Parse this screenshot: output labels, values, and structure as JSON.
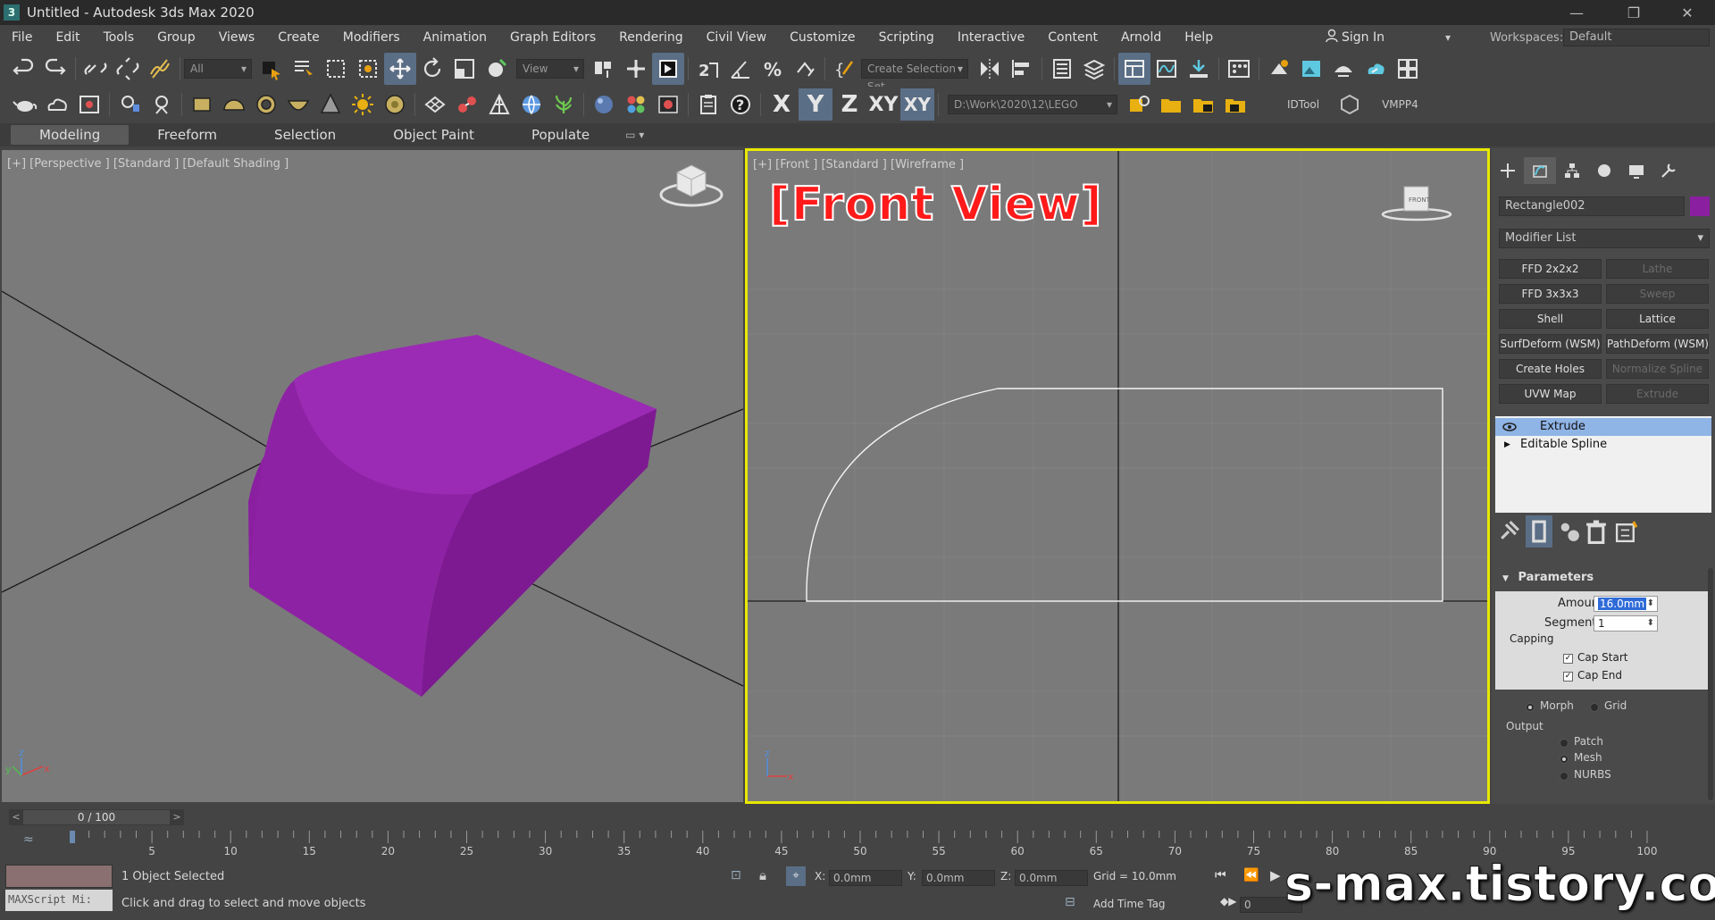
{
  "window": {
    "logo": "3",
    "title": "Untitled - Autodesk 3ds Max 2020",
    "minimize": "—",
    "maximize": "❐",
    "close": "✕"
  },
  "menu": {
    "items": [
      "File",
      "Edit",
      "Tools",
      "Group",
      "Views",
      "Create",
      "Modifiers",
      "Animation",
      "Graph Editors",
      "Rendering",
      "Civil View",
      "Customize",
      "Scripting",
      "Interactive",
      "Content",
      "Arnold",
      "Help"
    ],
    "sign_in": "Sign In",
    "workspaces_label": "Workspaces:",
    "workspace_value": "Default"
  },
  "toolbar1": {
    "filter_dropdown": "All",
    "refcoord_dropdown": "View",
    "selection_set": "Create Selection Set"
  },
  "toolbar2": {
    "axis_x": "X",
    "axis_y": "Y",
    "axis_z": "Z",
    "axis_xy": "XY",
    "axis_xy2": "XY",
    "project_path": "D:\\Work\\2020\\12\\LEGO",
    "idtool": "IDTool",
    "vmpp": "VMPP4"
  },
  "ribbon": {
    "tabs": [
      "Modeling",
      "Freeform",
      "Selection",
      "Object Paint",
      "Populate"
    ]
  },
  "viewports": {
    "left_label": "[+] [Perspective ] [Standard ] [Default Shading ]",
    "right_label": "[+] [Front ] [Standard ] [Wireframe ]",
    "front_banner": "[Front View]",
    "viewcube_front": "FRONT"
  },
  "command_panel": {
    "object_name": "Rectangle002",
    "object_color": "#8a1fa0",
    "modifier_list": "Modifier List",
    "buttons": [
      {
        "label": "FFD 2x2x2",
        "enabled": true
      },
      {
        "label": "Lathe",
        "enabled": false
      },
      {
        "label": "FFD 3x3x3",
        "enabled": true
      },
      {
        "label": "Sweep",
        "enabled": false
      },
      {
        "label": "Shell",
        "enabled": true
      },
      {
        "label": "Lattice",
        "enabled": true
      },
      {
        "label": "SurfDeform (WSM)",
        "enabled": true
      },
      {
        "label": "PathDeform (WSM)",
        "enabled": true
      },
      {
        "label": "Create Holes",
        "enabled": true
      },
      {
        "label": "Normalize Spline",
        "enabled": false
      },
      {
        "label": "UVW Map",
        "enabled": true
      },
      {
        "label": "Extrude",
        "enabled": false
      }
    ],
    "stack": [
      "Extrude",
      "Editable Spline"
    ],
    "parameters_title": "Parameters",
    "amount_label": "Amount:",
    "amount_value": "16.0mm",
    "segments_label": "Segments:",
    "segments_value": "1",
    "capping_label": "Capping",
    "cap_start": "Cap Start",
    "cap_end": "Cap End",
    "morph": "Morph",
    "grid": "Grid",
    "output_label": "Output",
    "patch": "Patch",
    "mesh": "Mesh",
    "nurbs": "NURBS"
  },
  "timeline": {
    "frame_display": "0 / 100",
    "ticks": [
      "5",
      "10",
      "15",
      "20",
      "25",
      "30",
      "35",
      "40",
      "45",
      "50",
      "55",
      "60",
      "65",
      "70",
      "75",
      "80",
      "85",
      "90",
      "95",
      "100"
    ]
  },
  "status": {
    "maxscript": "MAXScript Mi:",
    "objects_selected": "1 Object Selected",
    "prompt": "Click and drag to select and move objects",
    "x_label": "X:",
    "x_value": "0.0mm",
    "y_label": "Y:",
    "y_value": "0.0mm",
    "z_label": "Z:",
    "z_value": "0.0mm",
    "grid": "Grid = 10.0mm",
    "add_time_tag": "Add Time Tag",
    "frame_field": "0",
    "watermark": "s-max.tistory.com"
  }
}
